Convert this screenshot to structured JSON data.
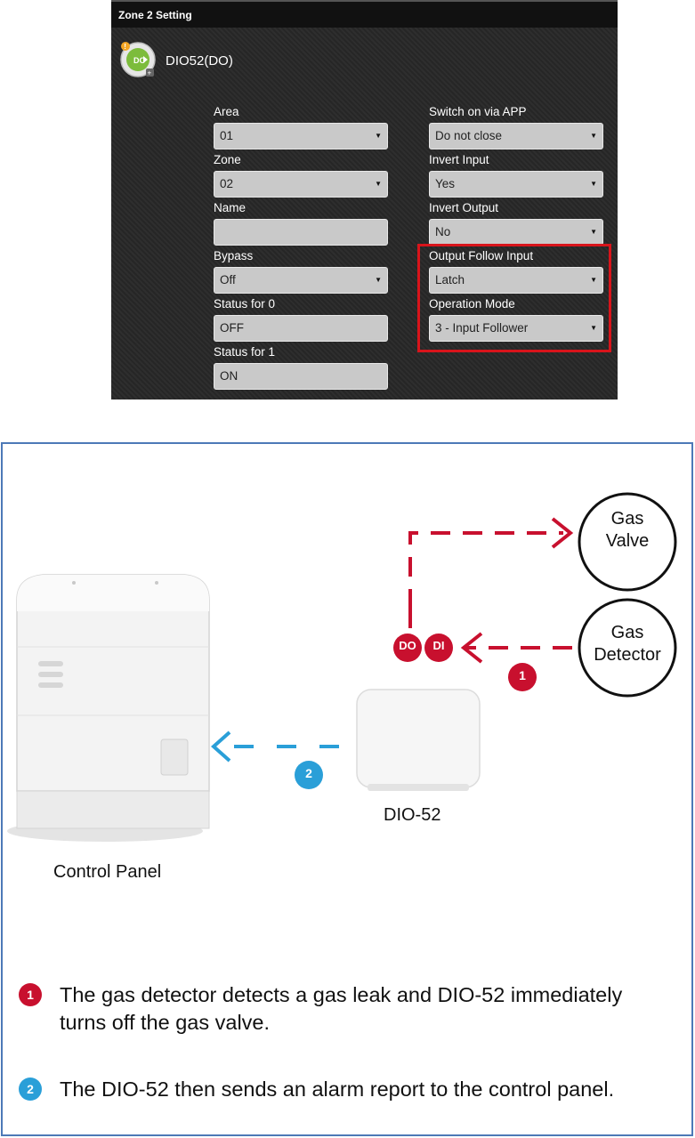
{
  "settings": {
    "title": "Zone 2 Setting",
    "device_name": "DIO52(DO)",
    "device_icon": "do-module-icon",
    "left_fields": [
      {
        "label": "Area",
        "value": "01",
        "type": "select"
      },
      {
        "label": "Zone",
        "value": "02",
        "type": "select"
      },
      {
        "label": "Name",
        "value": "",
        "type": "text"
      },
      {
        "label": "Bypass",
        "value": "Off",
        "type": "select"
      },
      {
        "label": "Status for 0",
        "value": "OFF",
        "type": "text"
      },
      {
        "label": "Status for 1",
        "value": "ON",
        "type": "text"
      }
    ],
    "right_fields": [
      {
        "label": "Switch on via APP",
        "value": "Do not close",
        "type": "select"
      },
      {
        "label": "Invert Input",
        "value": "Yes",
        "type": "select"
      },
      {
        "label": "Invert Output",
        "value": "No",
        "type": "select"
      },
      {
        "label": "Output Follow Input",
        "value": "Latch",
        "type": "select"
      },
      {
        "label": "Operation Mode",
        "value": "3 - Input Follower",
        "type": "select"
      }
    ],
    "highlight_color": "#d8141b"
  },
  "diagram": {
    "gas_valve_label": [
      "Gas",
      "Valve"
    ],
    "gas_detector_label": [
      "Gas",
      "Detector"
    ],
    "do_badge": "DO",
    "di_badge": "DI",
    "step1_badge": "1",
    "step2_badge": "2",
    "device_caption": "DIO-52",
    "panel_caption": "Control Panel",
    "notes": [
      {
        "num": "1",
        "text": "The gas detector detects a gas leak and DIO-52 immediately turns off the gas valve.",
        "color": "#c8102e"
      },
      {
        "num": "2",
        "text": "The DIO-52 then sends an alarm report to the control panel.",
        "color": "#2a9fd8"
      }
    ],
    "red_color": "#c8102e",
    "blue_color": "#2a9fd8",
    "border_color": "#4d79b7"
  }
}
